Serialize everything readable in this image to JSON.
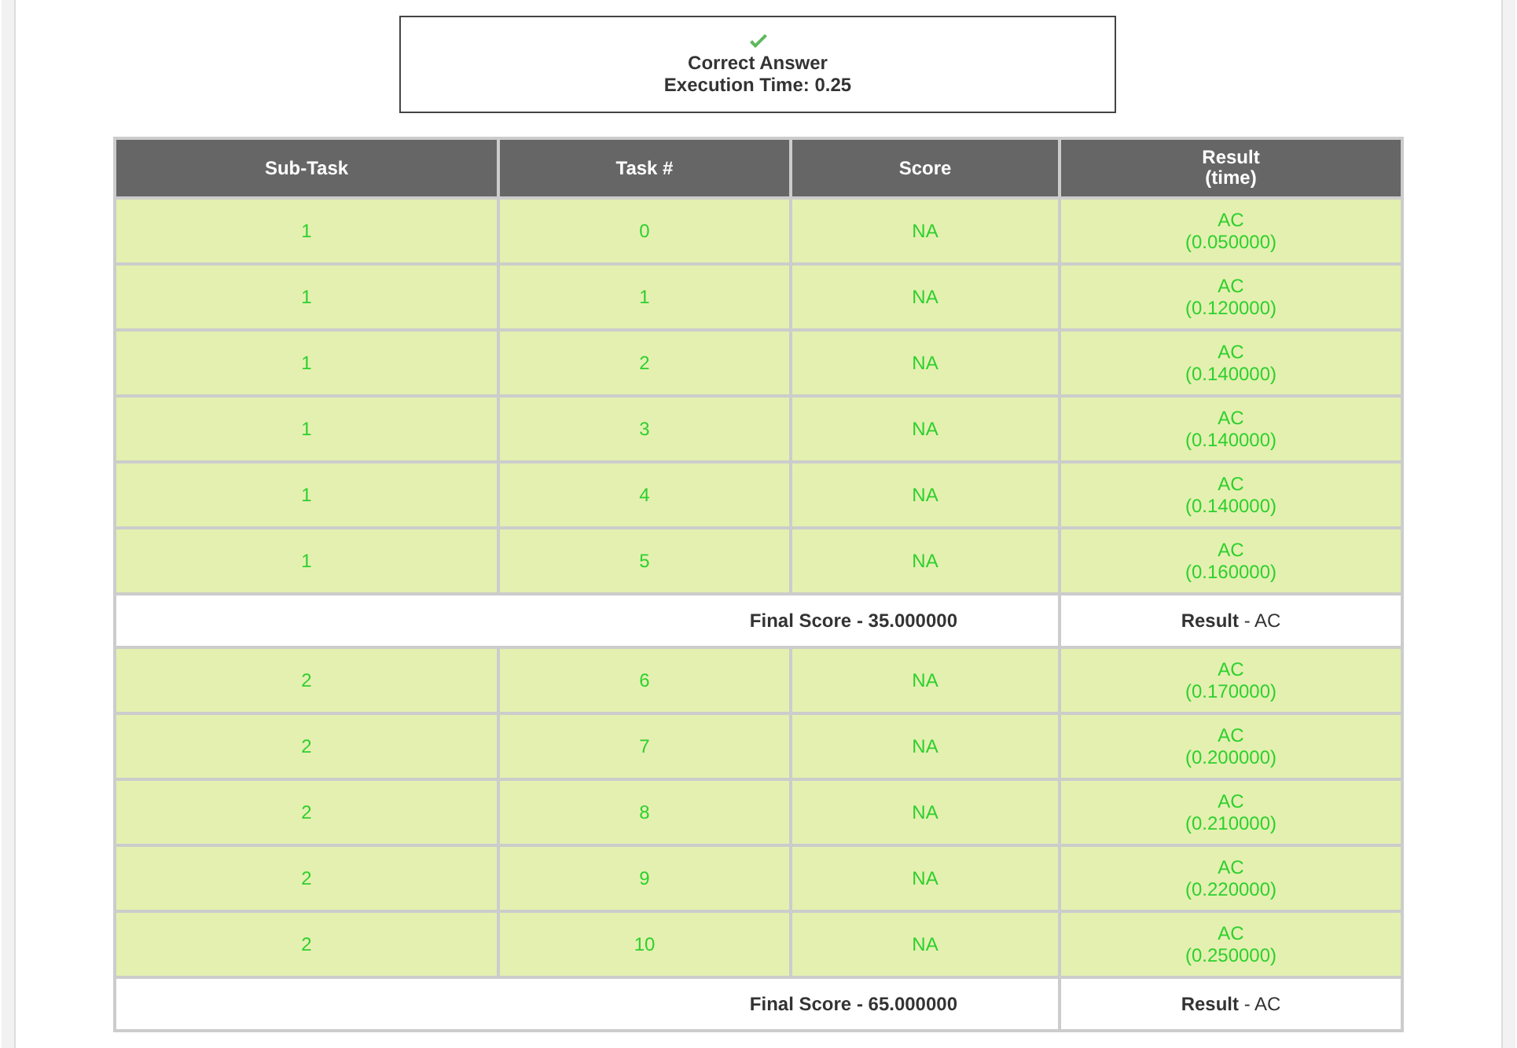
{
  "verdict": {
    "status": "Correct Answer",
    "execution_time": "Execution Time: 0.25"
  },
  "table": {
    "columns": [
      {
        "lines": [
          "Sub-Task"
        ]
      },
      {
        "lines": [
          "Task #"
        ]
      },
      {
        "lines": [
          "Score"
        ]
      },
      {
        "lines": [
          "Result",
          "(time)"
        ]
      }
    ],
    "groups": [
      {
        "rows": [
          {
            "subtask": "1",
            "task": "0",
            "score": "NA",
            "result": "AC",
            "time": "(0.050000)"
          },
          {
            "subtask": "1",
            "task": "1",
            "score": "NA",
            "result": "AC",
            "time": "(0.120000)"
          },
          {
            "subtask": "1",
            "task": "2",
            "score": "NA",
            "result": "AC",
            "time": "(0.140000)"
          },
          {
            "subtask": "1",
            "task": "3",
            "score": "NA",
            "result": "AC",
            "time": "(0.140000)"
          },
          {
            "subtask": "1",
            "task": "4",
            "score": "NA",
            "result": "AC",
            "time": "(0.140000)"
          },
          {
            "subtask": "1",
            "task": "5",
            "score": "NA",
            "result": "AC",
            "time": "(0.160000)"
          }
        ],
        "final_score": "Final Score - 35.000000",
        "result": "**Result** - AC"
      },
      {
        "rows": [
          {
            "subtask": "2",
            "task": "6",
            "score": "NA",
            "result": "AC",
            "time": "(0.170000)"
          },
          {
            "subtask": "2",
            "task": "7",
            "score": "NA",
            "result": "AC",
            "time": "(0.200000)"
          },
          {
            "subtask": "2",
            "task": "8",
            "score": "NA",
            "result": "AC",
            "time": "(0.210000)"
          },
          {
            "subtask": "2",
            "task": "9",
            "score": "NA",
            "result": "AC",
            "time": "(0.220000)"
          },
          {
            "subtask": "2",
            "task": "10",
            "score": "NA",
            "result": "AC",
            "time": "(0.250000)"
          }
        ],
        "final_score": "Final Score - 65.000000",
        "result": "**Result** - AC"
      }
    ]
  }
}
